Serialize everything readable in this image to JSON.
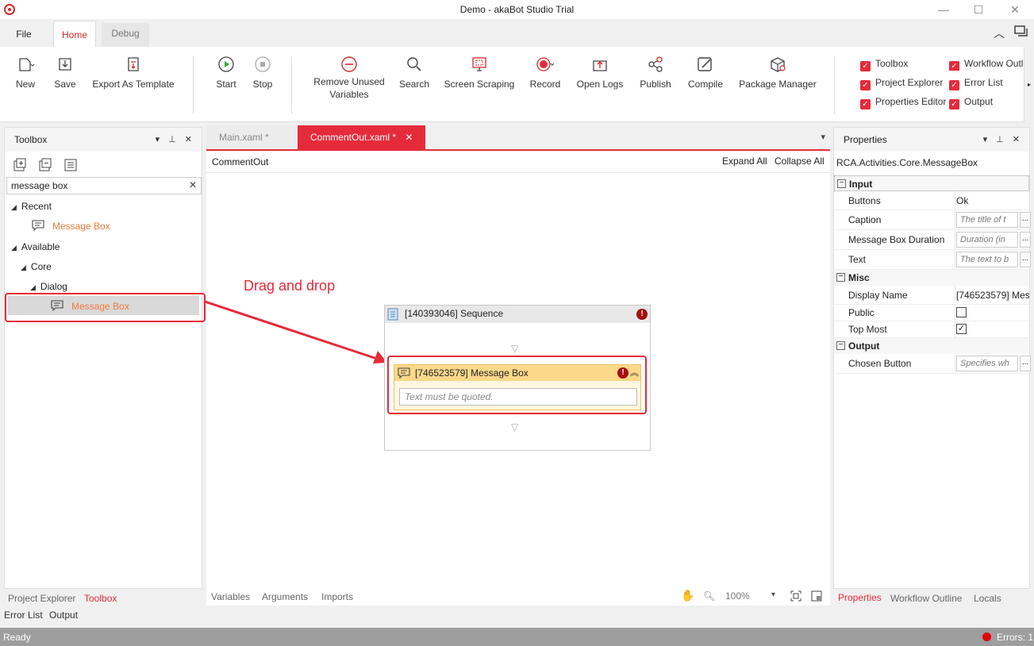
{
  "window": {
    "title": "Demo - akaBot Studio Trial",
    "minimize": "—",
    "maximize": "☐",
    "close": "✕"
  },
  "ribbon_tabs": [
    "File",
    "Home",
    "Debug"
  ],
  "ribbon": {
    "new": "New",
    "save": "Save",
    "export_as_template": "Export As Template",
    "start": "Start",
    "stop": "Stop",
    "remove_unused_line1": "Remove Unused",
    "remove_unused_line2": "Variables",
    "search": "Search",
    "screen_scraping": "Screen Scraping",
    "record": "Record",
    "open_logs": "Open Logs",
    "publish": "Publish",
    "compile": "Compile",
    "package_manager": "Package Manager",
    "checks": [
      "Toolbox",
      "Workflow Outl",
      "Project Explorer",
      "Error List",
      "Properties Editor",
      "Output"
    ]
  },
  "toolbox": {
    "title": "Toolbox",
    "search_value": "message box",
    "recent": "Recent",
    "recent_item": "Message Box",
    "available": "Available",
    "core": "Core",
    "dialog": "Dialog",
    "dialog_item": "Message Box",
    "bottom_tabs": [
      "Project Explorer",
      "Toolbox"
    ],
    "bottom_tabs2": [
      "Error List",
      "Output"
    ]
  },
  "annotation": "Drag and drop",
  "designer": {
    "tabs": [
      "Main.xaml *",
      "CommentOut.xaml *"
    ],
    "breadcrumb": "CommentOut",
    "expand_all": "Expand All",
    "collapse_all": "Collapse All",
    "sequence_title": "[140393046] Sequence",
    "msgbox_title": "[746523579] Message Box",
    "msgbox_placeholder": "Text must be quoted.",
    "bottom_tabs": [
      "Variables",
      "Arguments",
      "Imports"
    ],
    "zoom": "100%"
  },
  "properties": {
    "title": "Properties",
    "type_name": "RCA.Activities.Core.MessageBox",
    "cat_input": "Input",
    "buttons_key": "Buttons",
    "buttons_val": "Ok",
    "caption_key": "Caption",
    "caption_ph": "The title of t",
    "duration_key": "Message Box Duration",
    "duration_ph": "Duration (in",
    "text_key": "Text",
    "text_ph": "The text to b",
    "cat_misc": "Misc",
    "display_name_key": "Display Name",
    "display_name_val": "[746523579] Mes",
    "public_key": "Public",
    "top_most_key": "Top Most",
    "cat_output": "Output",
    "chosen_key": "Chosen Button",
    "chosen_ph": "Specifies wh",
    "bottom_tabs": [
      "Properties",
      "Workflow Outline",
      "Locals"
    ]
  },
  "status": {
    "ready": "Ready",
    "errors": "Errors: 1"
  },
  "colors": {
    "accent": "#e52b3a",
    "orange": "#ef7b3c",
    "status_bar": "#9e9e9e"
  }
}
